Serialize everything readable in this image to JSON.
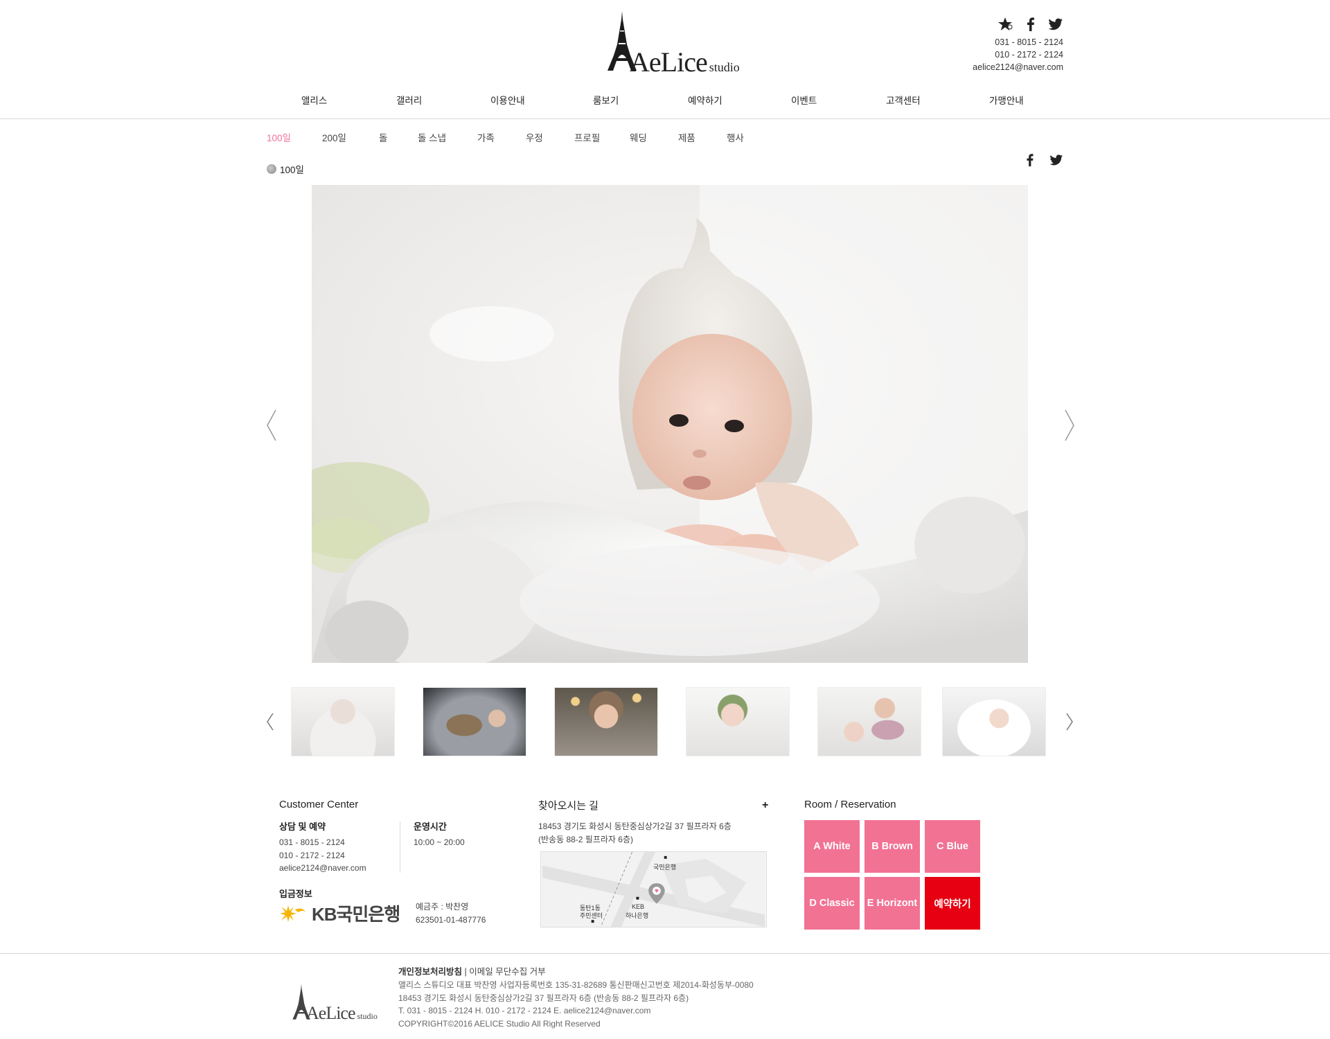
{
  "header": {
    "logo_main": "AeLice",
    "logo_sub": "studio",
    "phone1": "031 - 8015 - 2124",
    "phone2": "010 - 2172 - 2124",
    "email": "aelice2124@naver.com",
    "social_icons": [
      "star-icon",
      "facebook-icon",
      "twitter-icon"
    ]
  },
  "nav": {
    "items": [
      "앨리스",
      "갤러리",
      "이용안내",
      "룸보기",
      "예약하기",
      "이벤트",
      "고객센터",
      "가맹안내"
    ]
  },
  "subnav": {
    "items": [
      "100일",
      "200일",
      "돌",
      "돌 스냅",
      "가족",
      "우정",
      "프로필",
      "웨딩",
      "제품",
      "행사"
    ],
    "active": "100일"
  },
  "breadcrumb": {
    "label": "100일"
  },
  "gallery": {
    "thumbnail_count": 6
  },
  "footer_info": {
    "customer_center": {
      "title": "Customer Center",
      "consult_title": "상담 및 예약",
      "phone1": "031 - 8015 - 2124",
      "phone2": "010 - 2172 - 2124",
      "email": "aelice2124@naver.com",
      "hours_title": "운영시간",
      "hours": "10:00 ~ 20:00",
      "deposit_title": "입금정보",
      "bank_name": "KB국민은행",
      "account_holder": "예금주 : 박찬영",
      "account_number": "623501-01-487776"
    },
    "directions": {
      "title": "찾아오시는 길",
      "plus": "+",
      "address1": "18453 경기도 화성시 동탄중심상가2길 37 필프라자 6층",
      "address2": "(반송동 88-2 필프라자 6층)",
      "map_labels": {
        "bank1": "국민은행",
        "center_line1": "동탄1동",
        "center_line2": "주민센터",
        "keb_line1": "KEB",
        "keb_line2": "하나은행"
      }
    },
    "rooms": {
      "title": "Room / Reservation",
      "items": [
        "A White",
        "B Brown",
        "C Blue",
        "D Classic",
        "E Horizont",
        "예약하기"
      ]
    }
  },
  "footer": {
    "logo_main": "AeLice",
    "logo_sub": "studio",
    "link_privacy": "개인정보처리방침",
    "link_sep": " | ",
    "link_email": "이메일 무단수집 거부",
    "line1": "앨리스 스튜디오   대표 박찬영   사업자등록번호 135-31-82689   통신판매신고번호 제2014-화성동부-0080",
    "line2": "18453 경기도 화성시 동탄중심상가2길 37 필프라자 6층 (반송동 88-2 필프라자 6층)",
    "line3": "T. 031 - 8015 - 2124   H. 010 - 2172 - 2124   E. aelice2124@naver.com",
    "line4": "COPYRIGHT©2016 AELICE Studio All Right Reserved"
  },
  "colors": {
    "accent_pink": "#f27294",
    "reserve_red": "#e60012"
  }
}
